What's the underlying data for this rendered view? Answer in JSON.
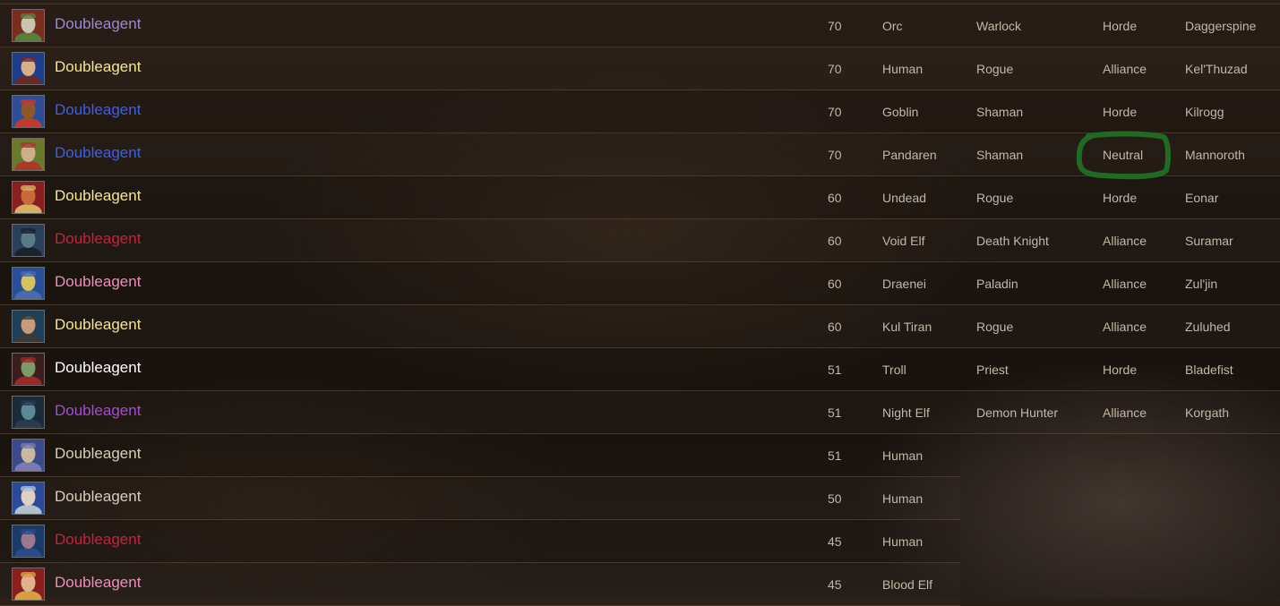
{
  "colors": {
    "warlock": "#9a8bd1",
    "rogue": "#f2e88a",
    "shaman": "#3c5fe6",
    "death_knight": "#c6213f",
    "paladin": "#f08cba",
    "priest": "#ffffff",
    "demon_hunter": "#a64ad6",
    "unknown": "#d8cdbd",
    "highlight": "#1f6b23"
  },
  "characters": [
    {
      "name": "Doubleagent",
      "name_color": "#9a8bd1",
      "avatar": "orc-warlock-portrait",
      "level": "70",
      "race": "Orc",
      "class": "Warlock",
      "faction": "Horde",
      "realm": "Daggerspine"
    },
    {
      "name": "Doubleagent",
      "name_color": "#f2e88a",
      "avatar": "human-rogue-portrait",
      "level": "70",
      "race": "Human",
      "class": "Rogue",
      "faction": "Alliance",
      "realm": "Kel'Thuzad"
    },
    {
      "name": "Doubleagent",
      "name_color": "#3c5fe6",
      "avatar": "goblin-shaman-portrait",
      "level": "70",
      "race": "Goblin",
      "class": "Shaman",
      "faction": "Horde",
      "realm": "Kilrogg"
    },
    {
      "name": "Doubleagent",
      "name_color": "#3c5fe6",
      "avatar": "pandaren-shaman-portrait",
      "level": "70",
      "race": "Pandaren",
      "class": "Shaman",
      "faction": "Neutral",
      "realm": "Mannoroth"
    },
    {
      "name": "Doubleagent",
      "name_color": "#f2e88a",
      "avatar": "undead-rogue-portrait",
      "level": "60",
      "race": "Undead",
      "class": "Rogue",
      "faction": "Horde",
      "realm": "Eonar"
    },
    {
      "name": "Doubleagent",
      "name_color": "#c6213f",
      "avatar": "void-elf-death-knight-portrait",
      "level": "60",
      "race": "Void Elf",
      "class": "Death Knight",
      "faction": "Alliance",
      "realm": "Suramar"
    },
    {
      "name": "Doubleagent",
      "name_color": "#f08cba",
      "avatar": "draenei-paladin-portrait",
      "level": "60",
      "race": "Draenei",
      "class": "Paladin",
      "faction": "Alliance",
      "realm": "Zul'jin"
    },
    {
      "name": "Doubleagent",
      "name_color": "#f2e88a",
      "avatar": "kul-tiran-rogue-portrait",
      "level": "60",
      "race": "Kul Tiran",
      "class": "Rogue",
      "faction": "Alliance",
      "realm": "Zuluhed"
    },
    {
      "name": "Doubleagent",
      "name_color": "#ffffff",
      "avatar": "troll-priest-portrait",
      "level": "51",
      "race": "Troll",
      "class": "Priest",
      "faction": "Horde",
      "realm": "Bladefist"
    },
    {
      "name": "Doubleagent",
      "name_color": "#a64ad6",
      "avatar": "night-elf-demon-hunter-portrait",
      "level": "51",
      "race": "Night Elf",
      "class": "Demon Hunter",
      "faction": "Alliance",
      "realm": "Korgath"
    },
    {
      "name": "Doubleagent",
      "name_color": "#d8cdbd",
      "avatar": "human-portrait",
      "level": "51",
      "race": "Human",
      "class": "",
      "faction": "",
      "realm": ""
    },
    {
      "name": "Doubleagent",
      "name_color": "#d8cdbd",
      "avatar": "human-portrait",
      "level": "50",
      "race": "Human",
      "class": "",
      "faction": "",
      "realm": ""
    },
    {
      "name": "Doubleagent",
      "name_color": "#c6213f",
      "avatar": "human-death-knight-portrait",
      "level": "45",
      "race": "Human",
      "class": "",
      "faction": "",
      "realm": ""
    },
    {
      "name": "Doubleagent",
      "name_color": "#f08cba",
      "avatar": "blood-elf-paladin-portrait",
      "level": "45",
      "race": "Blood Elf",
      "class": "",
      "faction": "",
      "realm": ""
    }
  ],
  "annotation": {
    "type": "hand-drawn-circle",
    "target": "Neutral",
    "color": "#1f6b23"
  }
}
